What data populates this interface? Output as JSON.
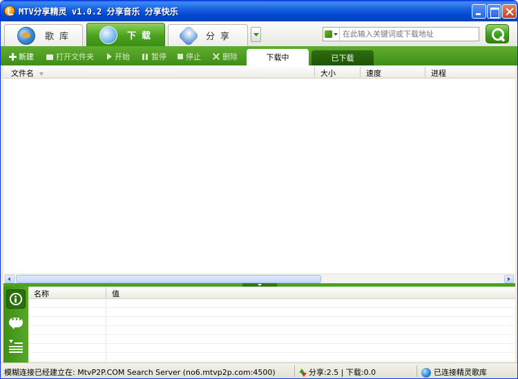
{
  "window": {
    "title": "MTV分享精灵 v1.0.2 分享音乐 分享快乐"
  },
  "nav_tabs": [
    {
      "label": "歌库",
      "icon": "globe-icon",
      "active": false
    },
    {
      "label": "下载",
      "icon": "download-icon",
      "active": true
    },
    {
      "label": "分享",
      "icon": "share-cube-icon",
      "active": false
    }
  ],
  "search": {
    "placeholder": "在此输入关键词或下载地址"
  },
  "toolbar": {
    "new_label": "新建",
    "open_folder_label": "打开文件夹",
    "start_label": "开始",
    "pause_label": "暂停",
    "stop_label": "停止",
    "delete_label": "删除"
  },
  "subtabs": {
    "downloading": "下载中",
    "downloaded": "已下载"
  },
  "list": {
    "columns": [
      "文件名",
      "大小",
      "速度",
      "进程"
    ],
    "rows": []
  },
  "details": {
    "columns": [
      "名称",
      "值"
    ]
  },
  "status": {
    "connection": "模糊连接已经建立在: MtvP2P.COM Search Server (no6.mtvp2p.com:4500)",
    "transfer": "分享:2.5 | 下载:0.0",
    "library": "已连接精灵歌库"
  },
  "colors": {
    "accent_green": "#4aa21f",
    "titlebar_blue": "#0048d1"
  }
}
